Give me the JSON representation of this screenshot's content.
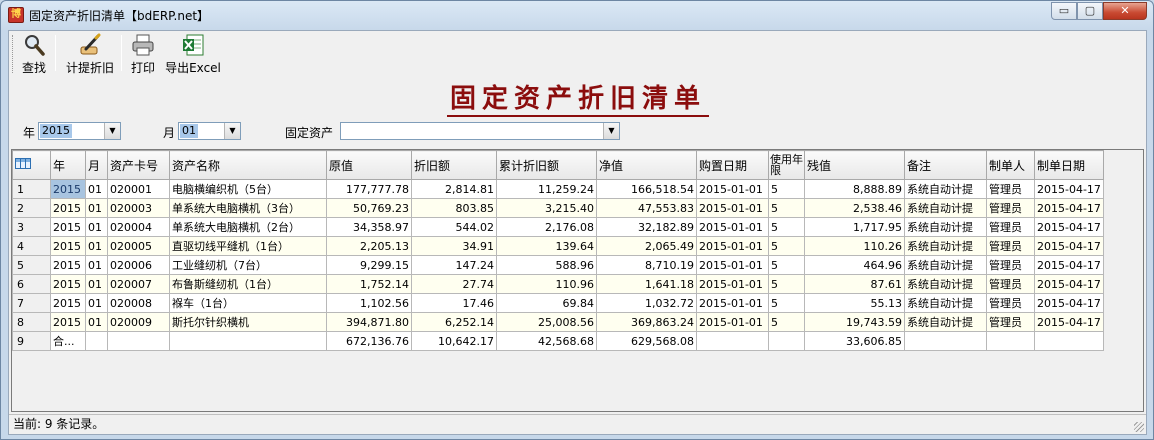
{
  "window": {
    "title": "固定资产折旧清单【bdERP.net】",
    "app_icon_glyph": "博",
    "buttons": {
      "minimize": "▭",
      "maximize": "▢",
      "close": "✕"
    }
  },
  "toolbar": {
    "find_label": "查找",
    "depreciate_label": "计提折旧",
    "print_label": "打印",
    "export_label": "导出Excel",
    "icons": {
      "find": "magnifier-icon",
      "depreciate": "pen-hand-icon",
      "print": "printer-icon",
      "export": "excel-icon"
    }
  },
  "report_title": "固定资产折旧清单",
  "filters": {
    "year_label": "年",
    "year_value": "2015",
    "month_label": "月",
    "month_value": "01",
    "asset_label": "固定资产",
    "asset_value": ""
  },
  "grid": {
    "columns": [
      "年",
      "月",
      "资产卡号",
      "资产名称",
      "原值",
      "折旧额",
      "累计折旧额",
      "净值",
      "购置日期",
      "使用年限",
      "残值",
      "备注",
      "制单人",
      "制单日期"
    ],
    "rows": [
      {
        "rn": "1",
        "year": "2015",
        "month": "01",
        "card": "020001",
        "name": "电脑横编织机（5台）",
        "original": "177,777.78",
        "depreciation": "2,814.81",
        "accumulated": "11,259.24",
        "net": "166,518.54",
        "purchase_date": "2015-01-01",
        "life": "5",
        "residual": "8,888.89",
        "note": "系统自动计提",
        "maker": "管理员",
        "make_date": "2015-04-17"
      },
      {
        "rn": "2",
        "year": "2015",
        "month": "01",
        "card": "020003",
        "name": "单系统大电脑横机（3台）",
        "original": "50,769.23",
        "depreciation": "803.85",
        "accumulated": "3,215.40",
        "net": "47,553.83",
        "purchase_date": "2015-01-01",
        "life": "5",
        "residual": "2,538.46",
        "note": "系统自动计提",
        "maker": "管理员",
        "make_date": "2015-04-17"
      },
      {
        "rn": "3",
        "year": "2015",
        "month": "01",
        "card": "020004",
        "name": "单系统大电脑横机（2台）",
        "original": "34,358.97",
        "depreciation": "544.02",
        "accumulated": "2,176.08",
        "net": "32,182.89",
        "purchase_date": "2015-01-01",
        "life": "5",
        "residual": "1,717.95",
        "note": "系统自动计提",
        "maker": "管理员",
        "make_date": "2015-04-17"
      },
      {
        "rn": "4",
        "year": "2015",
        "month": "01",
        "card": "020005",
        "name": "直驱切线平缝机（1台）",
        "original": "2,205.13",
        "depreciation": "34.91",
        "accumulated": "139.64",
        "net": "2,065.49",
        "purchase_date": "2015-01-01",
        "life": "5",
        "residual": "110.26",
        "note": "系统自动计提",
        "maker": "管理员",
        "make_date": "2015-04-17"
      },
      {
        "rn": "5",
        "year": "2015",
        "month": "01",
        "card": "020006",
        "name": "工业缝纫机（7台）",
        "original": "9,299.15",
        "depreciation": "147.24",
        "accumulated": "588.96",
        "net": "8,710.19",
        "purchase_date": "2015-01-01",
        "life": "5",
        "residual": "464.96",
        "note": "系统自动计提",
        "maker": "管理员",
        "make_date": "2015-04-17"
      },
      {
        "rn": "6",
        "year": "2015",
        "month": "01",
        "card": "020007",
        "name": "布鲁斯缝纫机（1台）",
        "original": "1,752.14",
        "depreciation": "27.74",
        "accumulated": "110.96",
        "net": "1,641.18",
        "purchase_date": "2015-01-01",
        "life": "5",
        "residual": "87.61",
        "note": "系统自动计提",
        "maker": "管理员",
        "make_date": "2015-04-17"
      },
      {
        "rn": "7",
        "year": "2015",
        "month": "01",
        "card": "020008",
        "name": "褓车（1台）",
        "original": "1,102.56",
        "depreciation": "17.46",
        "accumulated": "69.84",
        "net": "1,032.72",
        "purchase_date": "2015-01-01",
        "life": "5",
        "residual": "55.13",
        "note": "系统自动计提",
        "maker": "管理员",
        "make_date": "2015-04-17"
      },
      {
        "rn": "8",
        "year": "2015",
        "month": "01",
        "card": "020009",
        "name": "斯托尔针织横机",
        "original": "394,871.80",
        "depreciation": "6,252.14",
        "accumulated": "25,008.56",
        "net": "369,863.24",
        "purchase_date": "2015-01-01",
        "life": "5",
        "residual": "19,743.59",
        "note": "系统自动计提",
        "maker": "管理员",
        "make_date": "2015-04-17"
      }
    ],
    "total_row": {
      "rn": "9",
      "label": "合...",
      "original": "672,136.76",
      "depreciation": "10,642.17",
      "accumulated": "42,568.68",
      "net": "629,568.08",
      "residual": "33,606.85"
    }
  },
  "status": {
    "text": "当前: 9 条记录。"
  }
}
